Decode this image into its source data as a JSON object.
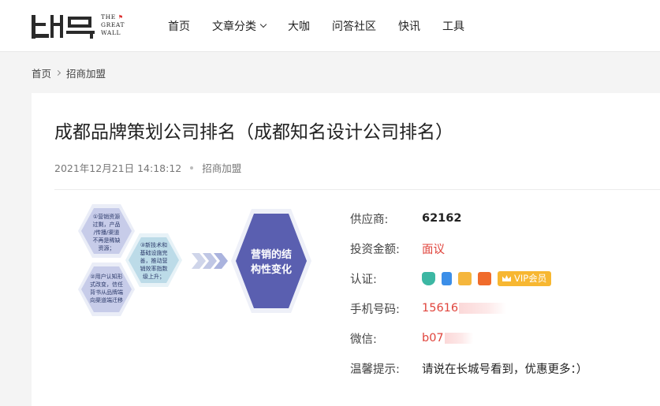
{
  "header": {
    "logo_text": [
      "THE",
      "GREAT",
      "WALL"
    ],
    "nav": [
      {
        "label": "首页",
        "has_dropdown": false
      },
      {
        "label": "文章分类",
        "has_dropdown": true
      },
      {
        "label": "大咖",
        "has_dropdown": false
      },
      {
        "label": "问答社区",
        "has_dropdown": false
      },
      {
        "label": "快讯",
        "has_dropdown": false
      },
      {
        "label": "工具",
        "has_dropdown": false
      }
    ]
  },
  "breadcrumb": {
    "home": "首页",
    "current": "招商加盟"
  },
  "article": {
    "title": "成都品牌策划公司排名（成都知名设计公司排名）",
    "date": "2021年12月21日 14:18:12",
    "category": "招商加盟"
  },
  "graphic": {
    "hex1": [
      "①营销资源",
      "过剩，产品",
      "/传播/渠道",
      "不再是稀缺",
      "资源；"
    ],
    "hex2": [
      "②用户认知形",
      "式改变，信任",
      "背书从品牌端",
      "向渠道端迁移"
    ],
    "hex3": [
      "③新技术和",
      "基础设施完",
      "善，推动营",
      "销效率指数",
      "级上升；"
    ],
    "main": [
      "营销的结",
      "构性变化"
    ]
  },
  "info": {
    "supplier_label": "供应商:",
    "supplier_value": "62162",
    "investment_label": "投资金额:",
    "investment_value": "面议",
    "cert_label": "认证:",
    "cert_icons": [
      "shield-icon",
      "phone-icon",
      "card-icon",
      "check-icon"
    ],
    "vip_label": "VIP会员",
    "phone_label": "手机号码:",
    "phone_value": "15616",
    "wechat_label": "微信:",
    "wechat_value": "b07",
    "tip_label": "温馨提示:",
    "tip_value": "请说在长城号看到，优惠更多：）"
  },
  "colors": {
    "accent_red": "#e0443c",
    "vip_gold": "#f7b731",
    "hex_purple": "#5a5fb0"
  }
}
